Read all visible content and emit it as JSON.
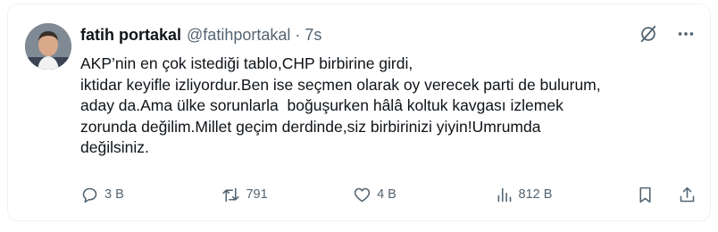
{
  "tweet": {
    "author": {
      "name": "fatih portakal",
      "handle": "@fatihportakal",
      "separator": "·",
      "time": "7s"
    },
    "text": "AKP’nin en çok istediği tablo,CHP birbirine girdi,\niktidar keyifle izliyordur.Ben ise seçmen olarak oy verecek parti de bulurum,\naday da.Ama ülke sorunlarla  boğuşurken hâlâ koltuk kavgası izlemek\nzorunda değilim.Millet geçim derdinde,siz birbirinizi yiyin!Umrumda\ndeğilsiniz.",
    "actions": {
      "replies": "3 B",
      "reposts": "791",
      "likes": "4 B",
      "views": "812 B"
    }
  },
  "icons": {
    "header": [
      "grok-icon",
      "more-icon"
    ],
    "actions": [
      "reply-icon",
      "repost-icon",
      "like-icon",
      "views-icon",
      "bookmark-icon",
      "share-icon"
    ]
  },
  "colors": {
    "text": "#0f1419",
    "muted": "#536471",
    "border": "#eff3f4"
  }
}
